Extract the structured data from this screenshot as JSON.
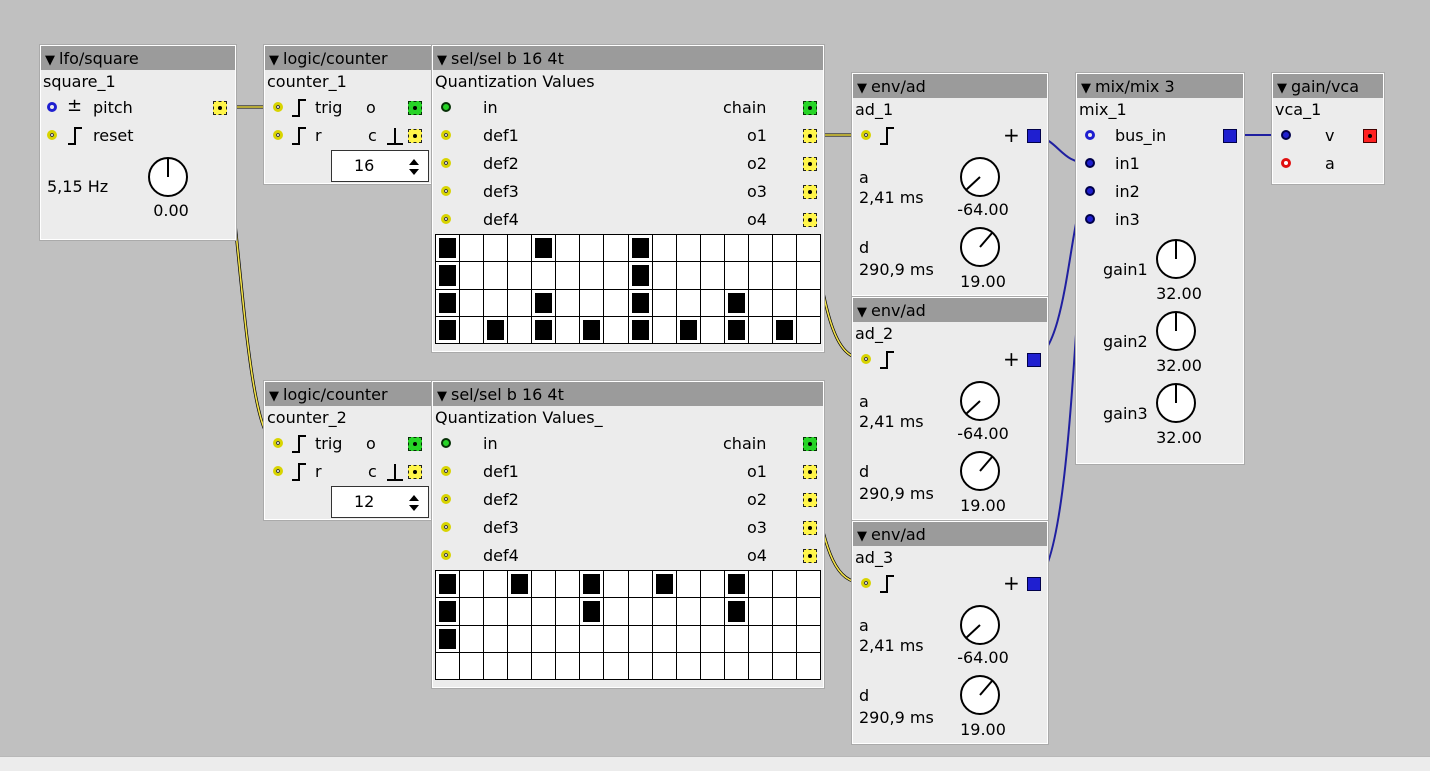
{
  "colors": {
    "background": "#c0c0c0",
    "panel": "#ececec",
    "header": "#9b9b9b",
    "wire_yellow": "#f2e14a",
    "wire_blue": "#1f1fa0"
  },
  "lfo": {
    "title": "lfo/square",
    "instance": "square_1",
    "inlet_pitch": "pitch",
    "inlet_reset": "reset",
    "freq": "5,15 Hz",
    "knob_value": "0.00",
    "pitch_symbol": "±"
  },
  "counter1": {
    "title": "logic/counter",
    "instance": "counter_1",
    "in_trig": "trig",
    "in_r": "r",
    "out_o": "o",
    "out_c": "c",
    "value": "16"
  },
  "counter2": {
    "title": "logic/counter",
    "instance": "counter_2",
    "in_trig": "trig",
    "in_r": "r",
    "out_o": "o",
    "out_c": "c",
    "value": "12"
  },
  "sel1": {
    "title": "sel/sel b 16 4t",
    "instance": "Quantization Values",
    "inputs": [
      "in",
      "def1",
      "def2",
      "def3",
      "def4"
    ],
    "outputs": [
      "chain",
      "o1",
      "o2",
      "o3",
      "o4"
    ],
    "rows": [
      [
        1,
        0,
        0,
        0,
        1,
        0,
        0,
        0,
        1,
        0,
        0,
        0,
        0,
        0,
        0,
        0
      ],
      [
        1,
        0,
        0,
        0,
        0,
        0,
        0,
        0,
        1,
        0,
        0,
        0,
        0,
        0,
        0,
        0
      ],
      [
        1,
        0,
        0,
        0,
        1,
        0,
        0,
        0,
        1,
        0,
        0,
        0,
        1,
        0,
        0,
        0
      ],
      [
        1,
        0,
        1,
        0,
        1,
        0,
        1,
        0,
        1,
        0,
        1,
        0,
        1,
        0,
        1,
        0
      ]
    ]
  },
  "sel2": {
    "title": "sel/sel b 16 4t",
    "instance": "Quantization Values_",
    "inputs": [
      "in",
      "def1",
      "def2",
      "def3",
      "def4"
    ],
    "outputs": [
      "chain",
      "o1",
      "o2",
      "o3",
      "o4"
    ],
    "rows": [
      [
        1,
        0,
        0,
        1,
        0,
        0,
        1,
        0,
        0,
        1,
        0,
        0,
        1,
        0,
        0,
        0
      ],
      [
        1,
        0,
        0,
        0,
        0,
        0,
        1,
        0,
        0,
        0,
        0,
        0,
        1,
        0,
        0,
        0
      ],
      [
        1,
        0,
        0,
        0,
        0,
        0,
        0,
        0,
        0,
        0,
        0,
        0,
        0,
        0,
        0,
        0
      ],
      [
        0,
        0,
        0,
        0,
        0,
        0,
        0,
        0,
        0,
        0,
        0,
        0,
        0,
        0,
        0,
        0
      ]
    ]
  },
  "env1": {
    "title": "env/ad",
    "instance": "ad_1",
    "a_label": "a",
    "a_value": "2,41 ms",
    "a_knob": "-64.00",
    "d_label": "d",
    "d_value": "290,9 ms",
    "d_knob": "19.00",
    "plus": "+"
  },
  "env2": {
    "title": "env/ad",
    "instance": "ad_2",
    "a_label": "a",
    "a_value": "2,41 ms",
    "a_knob": "-64.00",
    "d_label": "d",
    "d_value": "290,9 ms",
    "d_knob": "19.00",
    "plus": "+"
  },
  "env3": {
    "title": "env/ad",
    "instance": "ad_3",
    "a_label": "a",
    "a_value": "2,41 ms",
    "a_knob": "-64.00",
    "d_label": "d",
    "d_value": "290,9 ms",
    "d_knob": "19.00",
    "plus": "+"
  },
  "mix": {
    "title": "mix/mix 3",
    "instance": "mix_1",
    "bus_in": "bus_in",
    "in1": "in1",
    "in2": "in2",
    "in3": "in3",
    "gain1": "gain1",
    "gain1_value": "32.00",
    "gain2": "gain2",
    "gain2_value": "32.00",
    "gain3": "gain3",
    "gain3_value": "32.00"
  },
  "vca": {
    "title": "gain/vca",
    "instance": "vca_1",
    "in_v": "v",
    "in_a": "a"
  }
}
